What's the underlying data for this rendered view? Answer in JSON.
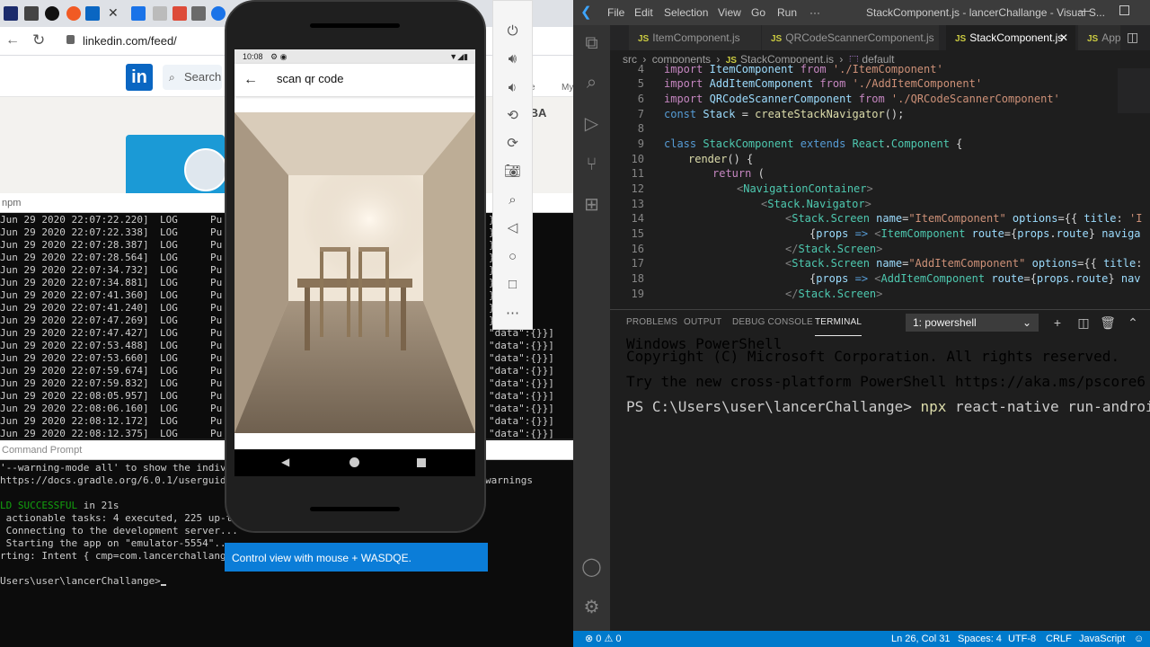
{
  "browser": {
    "url": "linkedin.com/feed/",
    "linkedin_logo": "in",
    "search_label": "Search",
    "ad_text": "ed MBA",
    "nav_partial_left": "e",
    "nav_partial_right": "My"
  },
  "npm_window": {
    "title": "npm",
    "log_rows": [
      {
        "ts": "Jun 29 2020 22:07:22.220]",
        "level": "LOG",
        "msg": "Pu",
        "tail": "}]]"
      },
      {
        "ts": "Jun 29 2020 22:07:22.338]",
        "level": "LOG",
        "msg": "Pu",
        "tail": "}]]"
      },
      {
        "ts": "Jun 29 2020 22:07:28.387]",
        "level": "LOG",
        "msg": "Pu",
        "tail": "}]]"
      },
      {
        "ts": "Jun 29 2020 22:07:28.564]",
        "level": "LOG",
        "msg": "Pu",
        "tail": "}]]"
      },
      {
        "ts": "Jun 29 2020 22:07:34.732]",
        "level": "LOG",
        "msg": "Pu",
        "tail": "}]]"
      },
      {
        "ts": "Jun 29 2020 22:07:34.881]",
        "level": "LOG",
        "msg": "Pu",
        "tail": "}]]"
      },
      {
        "ts": "Jun 29 2020 22:07:41.360]",
        "level": "LOG",
        "msg": "Pu",
        "tail": "}]]"
      },
      {
        "ts": "Jun 29 2020 22:07:41.240]",
        "level": "LOG",
        "msg": "Pu",
        "tail": "}]]"
      },
      {
        "ts": "Jun 29 2020 22:07:47.269]",
        "level": "LOG",
        "msg": "Pu",
        "tail": "}]]"
      },
      {
        "ts": "Jun 29 2020 22:07:47.427]",
        "level": "LOG",
        "msg": "Pu",
        "tail": "\"data\":{}}]"
      },
      {
        "ts": "Jun 29 2020 22:07:53.488]",
        "level": "LOG",
        "msg": "Pu",
        "tail": "\"data\":{}}]"
      },
      {
        "ts": "Jun 29 2020 22:07:53.660]",
        "level": "LOG",
        "msg": "Pu",
        "tail": "\"data\":{}}]"
      },
      {
        "ts": "Jun 29 2020 22:07:59.674]",
        "level": "LOG",
        "msg": "Pu",
        "tail": "\"data\":{}}]"
      },
      {
        "ts": "Jun 29 2020 22:07:59.832]",
        "level": "LOG",
        "msg": "Pu",
        "tail": "\"data\":{}}]"
      },
      {
        "ts": "Jun 29 2020 22:08:05.957]",
        "level": "LOG",
        "msg": "Pu",
        "tail": "\"data\":{}}]"
      },
      {
        "ts": "Jun 29 2020 22:08:06.160]",
        "level": "LOG",
        "msg": "Pu",
        "tail": "\"data\":{}}]"
      },
      {
        "ts": "Jun 29 2020 22:08:12.172]",
        "level": "LOG",
        "msg": "Pu",
        "tail": "\"data\":{}}]"
      },
      {
        "ts": "Jun 29 2020 22:08:12.375]",
        "level": "LOG",
        "msg": "Pu",
        "tail": "\"data\":{}}]"
      }
    ]
  },
  "cmd_window": {
    "title": "Command Prompt",
    "lines": [
      "'--warning-mode all' to show the indivi",
      "https://docs.gradle.org/6.0.1/userguide",
      "",
      "LD SUCCESSFUL in 21s",
      " actionable tasks: 4 executed, 225 up-to-",
      " Connecting to the development server...",
      " Starting the app on \"emulator-5554\"...",
      "rting: Intent { cmp=com.lancerchallange/",
      "",
      "Users\\user\\lancerChallange>"
    ],
    "warnings_tail": "warnings",
    "build_success_label": "LD SUCCESSFUL",
    "build_time": " in 21s"
  },
  "emulator": {
    "status_time": "10:08",
    "app_title": "scan qr code",
    "tooltip": "Control view with mouse + WASDQE.",
    "toolbar_buttons": [
      "power",
      "volume-up",
      "volume-down",
      "rotate-left",
      "rotate-right",
      "screenshot",
      "zoom",
      "back",
      "home",
      "overview",
      "more"
    ]
  },
  "vscode": {
    "menu": [
      "File",
      "Edit",
      "Selection",
      "View",
      "Go",
      "Run",
      "···"
    ],
    "window_title": "StackComponent.js - lancerChallange - Visual S...",
    "tabs": [
      {
        "label": "ItemComponent.js",
        "active": false
      },
      {
        "label": "QRCodeScannerComponent.js",
        "active": false
      },
      {
        "label": "StackComponent.js",
        "active": true
      },
      {
        "label": "App",
        "active": false
      }
    ],
    "breadcrumb": [
      "src",
      "components",
      "StackComponent.js",
      "default"
    ],
    "line_numbers": [
      "4",
      "5",
      "6",
      "7",
      "8",
      "9",
      "10",
      "11",
      "12",
      "13",
      "14",
      "15",
      "16",
      "17",
      "18",
      "19"
    ],
    "panel_tabs": [
      "PROBLEMS",
      "OUTPUT",
      "DEBUG CONSOLE",
      "TERMINAL"
    ],
    "terminal_select": "1: powershell",
    "terminal_lines": [
      "Windows PowerShell",
      "Copyright (C) Microsoft Corporation. All rights reserved.",
      "",
      "Try the new cross-platform PowerShell https://aka.ms/pscore6",
      ""
    ],
    "prompt": "PS C:\\Users\\user\\lancerChallange> ",
    "command_npx": "npx",
    "command_rest": " react-native run-android",
    "status": {
      "errors": "0",
      "warnings": "0",
      "position": "Ln 26, Col 31",
      "spaces": "Spaces: 4",
      "encoding": "UTF-8",
      "eol": "CRLF",
      "language": "JavaScript"
    }
  }
}
